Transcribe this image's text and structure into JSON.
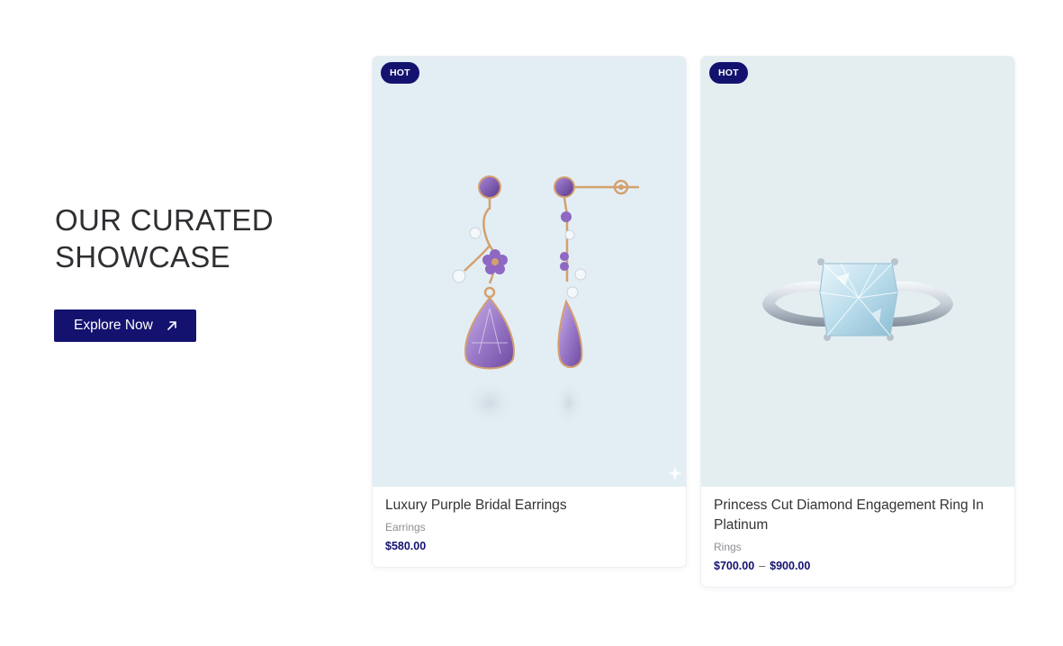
{
  "intro": {
    "title_line1": "OUR CURATED",
    "title_line2": "SHOWCASE",
    "button_label": "Explore Now",
    "button_icon": "arrow-up-right-icon"
  },
  "colors": {
    "accent": "#14126f",
    "card_bg_1": "#e3eef4",
    "card_bg_2": "#e4eef1",
    "text": "#333333",
    "muted": "#8d8d94"
  },
  "products": [
    {
      "badge": "HOT",
      "name": "Luxury Purple Bridal Earrings",
      "category": "Earrings",
      "price": "$580.00",
      "image": "purple-earrings-image"
    },
    {
      "badge": "HOT",
      "name": "Princess Cut Diamond Engagement Ring In Platinum",
      "category": "Rings",
      "price_min": "$700.00",
      "price_sep": "–",
      "price_max": "$900.00",
      "image": "diamond-ring-image"
    }
  ]
}
